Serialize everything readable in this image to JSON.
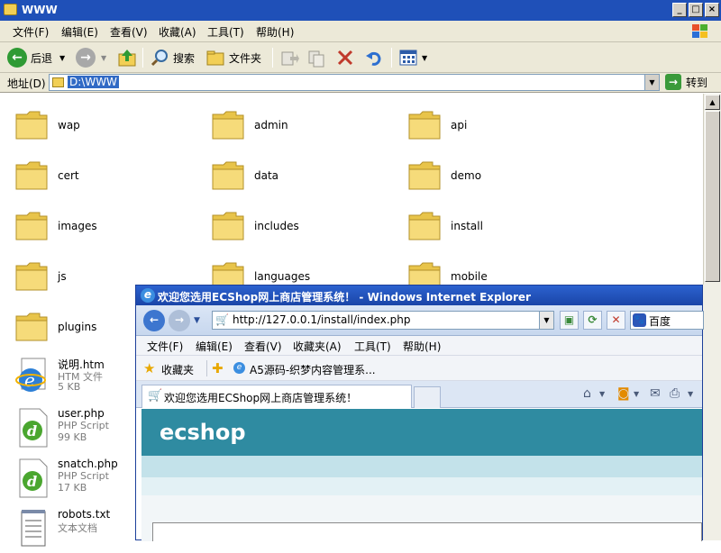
{
  "explorer": {
    "title": "WWW",
    "window_buttons": [
      "_",
      "□",
      "×"
    ],
    "menu": [
      "文件(F)",
      "编辑(E)",
      "查看(V)",
      "收藏(A)",
      "工具(T)",
      "帮助(H)"
    ],
    "toolbar": {
      "back_label": "后退",
      "search_label": "搜索",
      "folders_label": "文件夹"
    },
    "address": {
      "label": "地址(D)",
      "value": "D:\\WWW",
      "go_label": "转到"
    },
    "folders": [
      {
        "name": "wap"
      },
      {
        "name": "admin"
      },
      {
        "name": "api"
      },
      {
        "name": "cert"
      },
      {
        "name": "data"
      },
      {
        "name": "demo"
      },
      {
        "name": "images"
      },
      {
        "name": "includes"
      },
      {
        "name": "install"
      },
      {
        "name": "js"
      },
      {
        "name": "languages"
      },
      {
        "name": "mobile"
      },
      {
        "name": "plugins"
      }
    ],
    "files": [
      {
        "name": "说明.htm",
        "type": "HTM 文件",
        "size": "5 KB",
        "icon": "ie-document-icon"
      },
      {
        "name": "user.php",
        "type": "PHP Script",
        "size": "99 KB",
        "icon": "php-script-icon"
      },
      {
        "name": "snatch.php",
        "type": "PHP Script",
        "size": "17 KB",
        "icon": "php-script-icon"
      },
      {
        "name": "robots.txt",
        "type": "文本文档",
        "size": "",
        "icon": "text-document-icon"
      }
    ]
  },
  "ie": {
    "title": "欢迎您选用ECShop网上商店管理系统！ - Windows Internet Explorer",
    "url": "http://127.0.0.1/install/index.php",
    "search_placeholder": "百度",
    "menu": [
      "文件(F)",
      "编辑(E)",
      "查看(V)",
      "收藏夹(A)",
      "工具(T)",
      "帮助(H)"
    ],
    "favorites_label": "收藏夹",
    "favorite_link": "A5源码-织梦内容管理系...",
    "tab_label": "欢迎您选用ECShop网上商店管理系统！",
    "page": {
      "logo": "ecshop",
      "header_color": "#2f8ba1"
    }
  }
}
